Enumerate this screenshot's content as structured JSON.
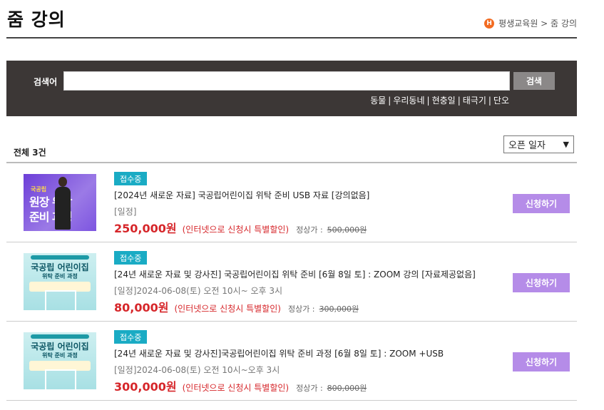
{
  "header": {
    "title": "줌 강의",
    "breadcrumb": {
      "home_icon": "home-icon",
      "home_letter": "H",
      "path": "평생교육원 > 줌 강의"
    }
  },
  "search": {
    "label": "검색어",
    "value": "",
    "placeholder": "",
    "button_label": "검색",
    "keywords": [
      "동물",
      "우리동네",
      "현충일",
      "태극기",
      "단오"
    ]
  },
  "list": {
    "total_label": "전체 3건",
    "sort": {
      "selected": "오픈 일자"
    },
    "items": [
      {
        "thumb_style": "purple",
        "thumb_small": "국공립",
        "thumb_line1": "원장 위탁",
        "thumb_line2": "준비 과정",
        "badge": "접수중",
        "title": "[2024년 새로운 자료] 국공립어린이집 위탁 준비 USB 자료 [강의없음]",
        "schedule": "[일정]",
        "price": "250,000원",
        "discount_note": "(인터넷으로 신청시 특별할인)",
        "regular_label": "정상가 :",
        "regular_price": "500,000원",
        "apply_label": "신청하기"
      },
      {
        "thumb_style": "teal",
        "thumb_title": "국공립 어린이집",
        "thumb_sub": "위탁 준비 과정",
        "badge": "접수중",
        "title": "[24년 새로운 자료 및 강사진] 국공립어린이집 위탁 준비 [6월 8일 토] : ZOOM 강의 [자료제공없음]",
        "schedule": "[일정]2024-06-08(토) 오전 10시~ 오후 3시",
        "price": "80,000원",
        "discount_note": "(인터넷으로 신청시 특별할인)",
        "regular_label": "정상가 :",
        "regular_price": "300,000원",
        "apply_label": "신청하기"
      },
      {
        "thumb_style": "teal",
        "thumb_title": "국공립 어린이집",
        "thumb_sub": "위탁 준비 과정",
        "badge": "접수중",
        "title": "[24년 새로운 자료 및 강사진]국공립어린이집 위탁 준비 과정 [6월 8일 토] : ZOOM +USB",
        "schedule": "[일정]2024-06-08(토) 오전 10시~오후 3시",
        "price": "300,000원",
        "discount_note": "(인터넷으로 신청시 특별할인)",
        "regular_label": "정상가 :",
        "regular_price": "800,000원",
        "apply_label": "신청하기"
      }
    ]
  },
  "colors": {
    "search_panel_bg": "#3c3736",
    "badge": "#1aabc4",
    "price": "#d6262a",
    "apply_button": "#b58ce8"
  }
}
